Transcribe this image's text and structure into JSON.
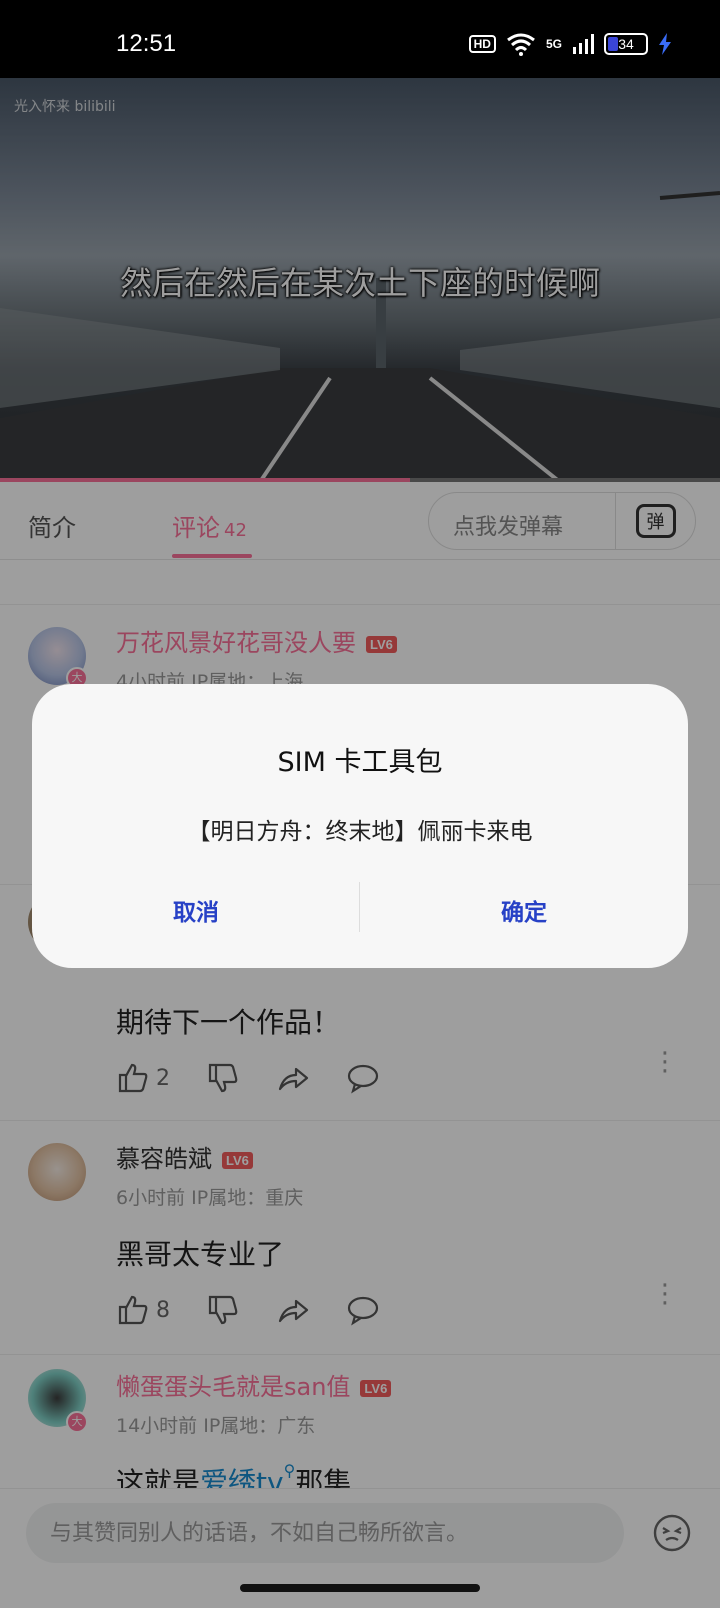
{
  "status_bar": {
    "time": "12:51",
    "hd": "HD",
    "network": "5G",
    "battery": "34",
    "battery_fraction": 0.34
  },
  "video": {
    "watermark": "光入怀来 bilibili",
    "subtitle": "然后在然后在某次土下座的时候啊",
    "progress_fraction": 0.57
  },
  "tabs": {
    "intro": "简介",
    "comments": "评论",
    "comments_count": "42"
  },
  "danmaku": {
    "placeholder": "点我发弹幕",
    "icon_label": "弹"
  },
  "comments": [
    {
      "username": "万花风景好花哥没人要",
      "level": "LV6",
      "meta": "4小时前 IP属地：上海",
      "badge": "大"
    },
    {
      "content": "期待下一个作品！",
      "likes": "2"
    },
    {
      "username": "慕容皓斌",
      "level": "LV6",
      "meta": "6小时前 IP属地：重庆",
      "content": "黑哥太专业了",
      "likes": "8"
    },
    {
      "username": "懒蛋蛋头毛就是san值",
      "level": "LV6",
      "meta": "14小时前 IP属地：广东",
      "badge": "大",
      "content_prefix": "这就是",
      "content_link": "爱绣tv",
      "content_suffix": "那集"
    }
  ],
  "comment_input": {
    "placeholder": "与其赞同别人的话语，不如自己畅所欲言。"
  },
  "dialog": {
    "title": "SIM 卡工具包",
    "message": "【明日方舟：终末地】佩丽卡来电",
    "cancel": "取消",
    "confirm": "确定"
  },
  "colors": {
    "accent": "#fb7299",
    "dialog_button": "#2741c6",
    "link": "#178bcf"
  }
}
